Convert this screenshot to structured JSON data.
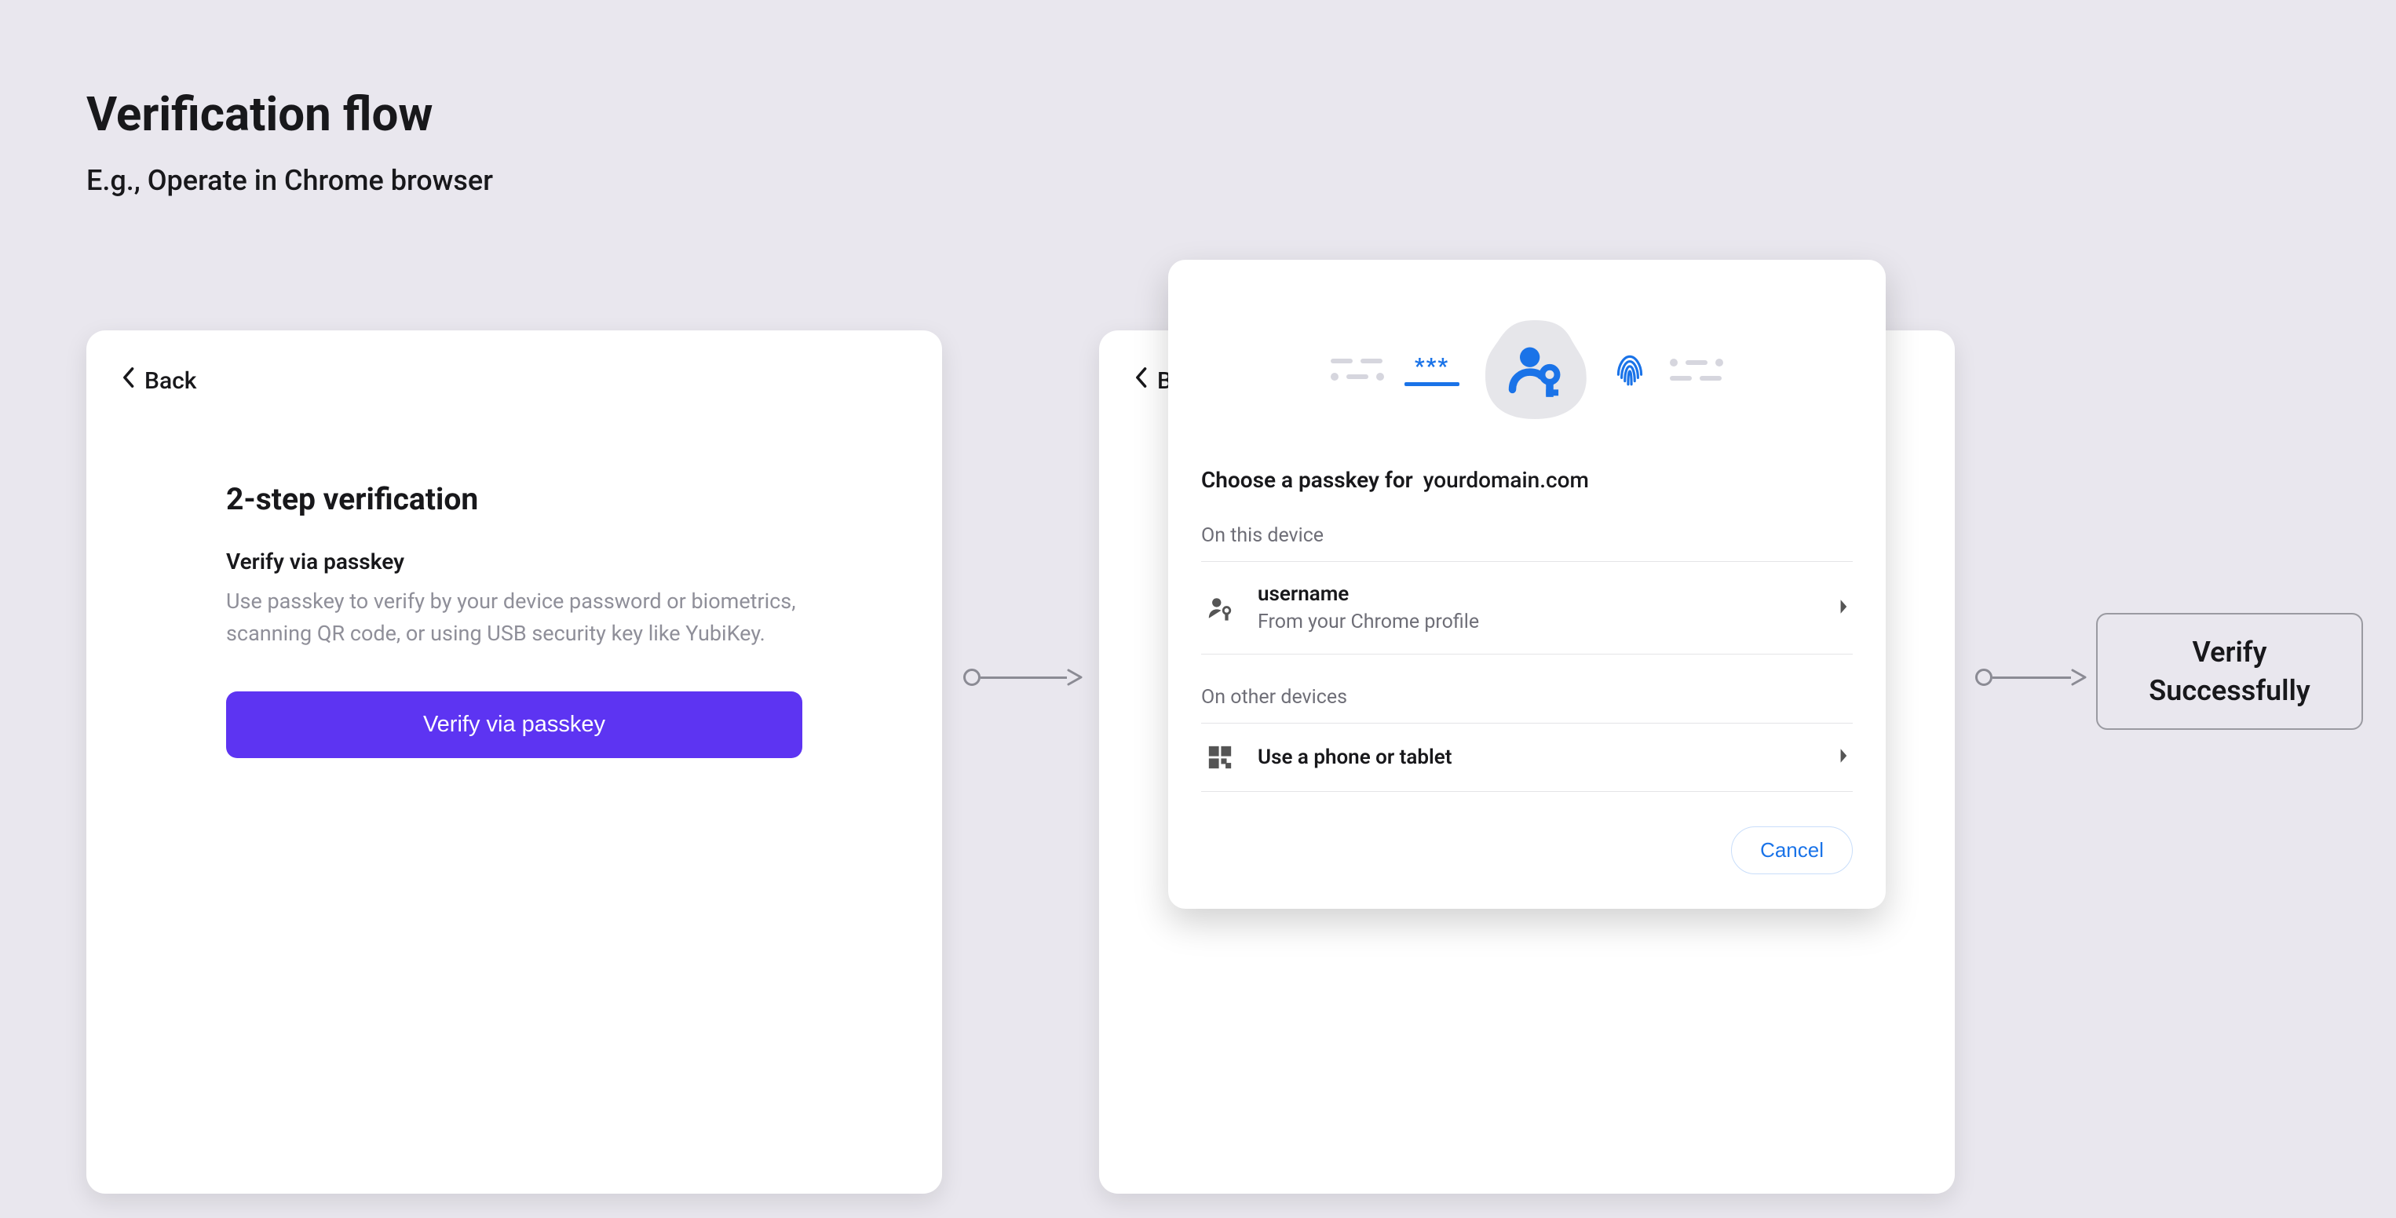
{
  "header": {
    "title": "Verification flow",
    "subtitle": "E.g., Operate in Chrome browser"
  },
  "step1": {
    "back_label": "Back",
    "heading": "2-step verification",
    "subheading": "Verify via passkey",
    "description": "Use passkey to verify by your device password or biometrics, scanning QR code, or using USB security key like YubiKey.",
    "button_label": "Verify via passkey"
  },
  "step2_under": {
    "back_label_truncated": "B"
  },
  "step2_modal": {
    "title_prefix": "Choose a passkey for",
    "domain": "yourdomain.com",
    "section_this_device": "On this device",
    "option_profile": {
      "title": "username",
      "subtitle": "From your Chrome profile"
    },
    "section_other_devices": "On other devices",
    "option_phone": {
      "title": "Use a phone or tablet"
    },
    "cancel_label": "Cancel"
  },
  "result": {
    "line1": "Verify",
    "line2": "Successfully"
  }
}
